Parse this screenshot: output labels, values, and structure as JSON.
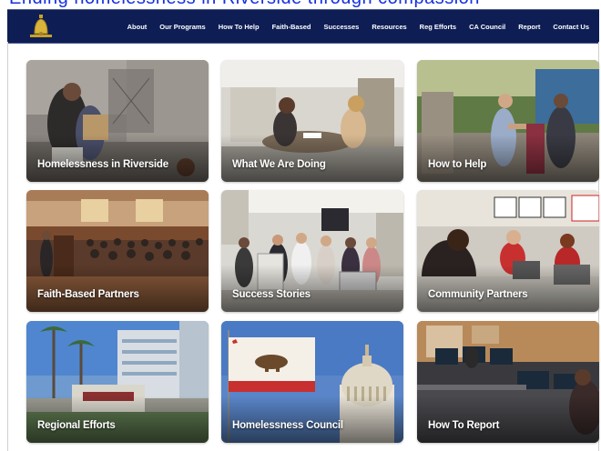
{
  "nav": {
    "items": [
      "About",
      "Our Programs",
      "How To Help",
      "Faith-Based",
      "Successes",
      "Resources",
      "Reg Efforts",
      "CA Council",
      "Report",
      "Contact Us"
    ]
  },
  "colors": {
    "navbar": "#0e1e55",
    "accent": "#c8a227",
    "tile_text": "#ffffff"
  },
  "tiles": [
    {
      "label": "Homelessness in Riverside"
    },
    {
      "label": "What We Are Doing"
    },
    {
      "label": "How to Help"
    },
    {
      "label": "Faith-Based Partners"
    },
    {
      "label": "Success Stories"
    },
    {
      "label": "Community Partners"
    },
    {
      "label": "Regional Efforts"
    },
    {
      "label": "Homelessness Council"
    },
    {
      "label": "How To Report"
    }
  ]
}
